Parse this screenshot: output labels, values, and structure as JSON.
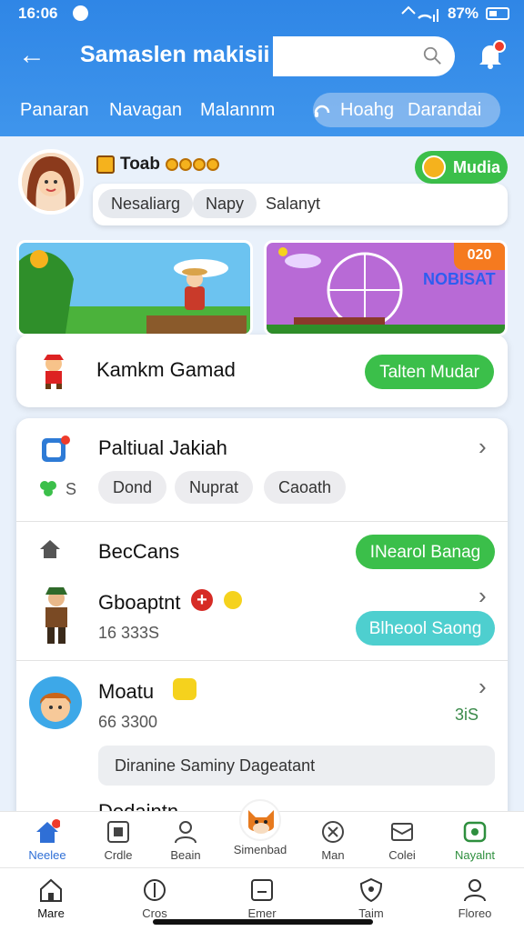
{
  "status": {
    "time": "16:06",
    "battery": "87%"
  },
  "header": {
    "title": "Samaslen makisii",
    "search_placeholder": ""
  },
  "subnav": {
    "items": [
      "Panaran",
      "Navagan",
      "Malannm"
    ],
    "pill_items": [
      "Hoahg",
      "Darandai"
    ]
  },
  "profile": {
    "coin_label": "Toab",
    "mudia_label": "Mudia",
    "chips": [
      "Nesaliarg",
      "Napy",
      "Salanyt"
    ]
  },
  "banners": {
    "right_badge": "020",
    "right_logo": "NOBISAT"
  },
  "featured": {
    "title": "Kamkm Gamad",
    "button": "Talten Mudar"
  },
  "list": {
    "row1": {
      "title": "Paltiual Jakiah",
      "icon_sub": "S",
      "chips": [
        "Dond",
        "Nuprat",
        "Caoath"
      ]
    },
    "row2": {
      "title": "BecCans",
      "button": "INearol Banag"
    },
    "row3": {
      "title": "Gboaptnt",
      "sub": "16 333S",
      "button": "Blheool Saong"
    },
    "row4": {
      "title": "Moatu",
      "sub": "66 3300",
      "side": "3iS",
      "info": "Diranine Saminy Dageatant"
    },
    "row5": {
      "title": "Dodaintn"
    }
  },
  "tabbar1": [
    {
      "label": "Neelee",
      "icon": "home-icon"
    },
    {
      "label": "Crdle",
      "icon": "grid-icon"
    },
    {
      "label": "Beain",
      "icon": "person-icon"
    },
    {
      "label": "Simenbad",
      "icon": "fox-icon"
    },
    {
      "label": "Man",
      "icon": "target-icon"
    },
    {
      "label": "Colei",
      "icon": "box-icon"
    },
    {
      "label": "Nayalnt",
      "icon": "gift-icon"
    }
  ],
  "tabbar2": [
    {
      "label": "Mare",
      "icon": "house-outline-icon"
    },
    {
      "label": "Cros",
      "icon": "compass-icon"
    },
    {
      "label": "Emer",
      "icon": "message-icon"
    },
    {
      "label": "Taim",
      "icon": "shield-icon"
    },
    {
      "label": "Floreo",
      "icon": "user-icon"
    }
  ],
  "colors": {
    "primary": "#2f86e6",
    "green": "#3bbf4a",
    "teal": "#4ecfcf",
    "red": "#ee3b2b"
  }
}
